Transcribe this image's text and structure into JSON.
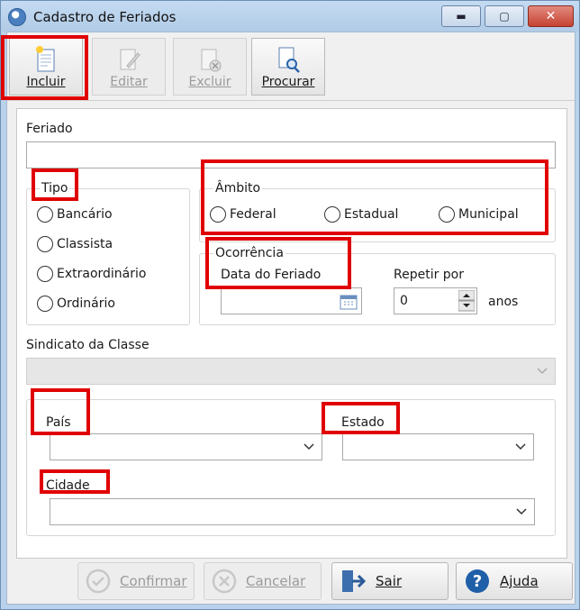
{
  "window": {
    "title": "Cadastro de Feriados",
    "min_glyph": "▬",
    "max_glyph": "▢",
    "close_glyph": "✕"
  },
  "toolbar": {
    "incluir": "Incluir",
    "editar": "Editar",
    "excluir": "Excluir",
    "procurar": "Procurar"
  },
  "form": {
    "feriado_label": "Feriado",
    "feriado_value": "",
    "tipo_label": "Tipo",
    "tipo_options": [
      "Bancário",
      "Classista",
      "Extraordinário",
      "Ordinário"
    ],
    "ambito_label": "Âmbito",
    "ambito_options": [
      "Federal",
      "Estadual",
      "Municipal"
    ],
    "ocorrencia_label": "Ocorrência",
    "data_label": "Data do Feriado",
    "data_value": "",
    "repetir_label": "Repetir por",
    "repetir_value": "0",
    "anos_label": "anos",
    "sindicato_label": "Sindicato da Classe",
    "pais_label": "País",
    "estado_label": "Estado",
    "cidade_label": "Cidade"
  },
  "footer": {
    "confirmar": "Confirmar",
    "cancelar": "Cancelar",
    "sair": "Sair",
    "ajuda": "Ajuda"
  },
  "colors": {
    "highlight": "#e00000",
    "window_frame": "#b9d1ea",
    "help_blue": "#1f5fa8"
  }
}
